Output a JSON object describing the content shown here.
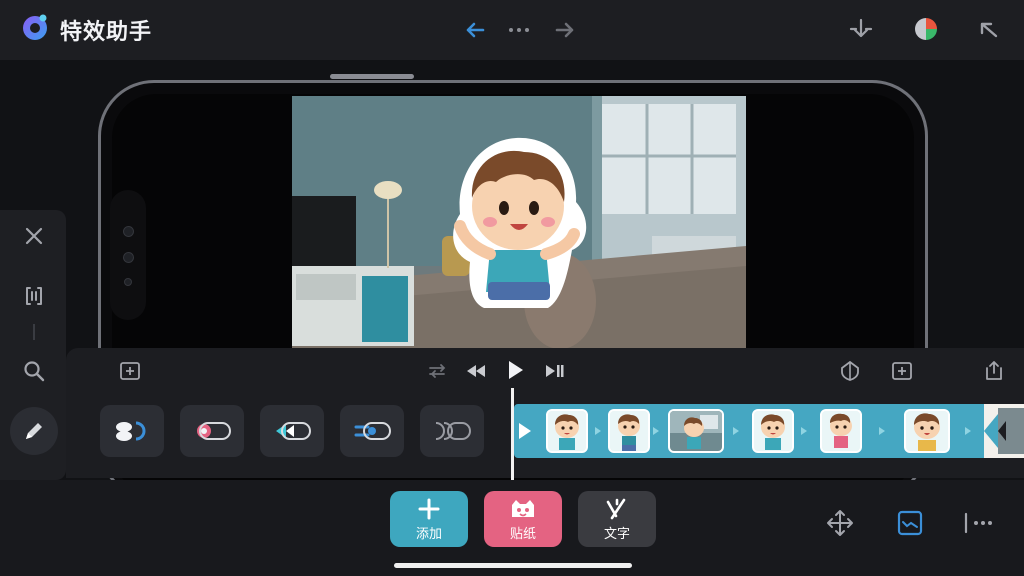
{
  "app": {
    "title": "特效助手"
  },
  "bottom_actions": [
    {
      "label": "添加",
      "icon": "plus-icon",
      "color": "#3ea7bf"
    },
    {
      "label": "贴纸",
      "icon": "sticker-icon",
      "color": "#e46382"
    },
    {
      "label": "文字",
      "icon": "text-icon",
      "color": "#3a3b40"
    }
  ],
  "colors": {
    "accent_blue": "#3b8fd8",
    "strip_teal": "#45a7c2",
    "pink": "#e46382"
  }
}
